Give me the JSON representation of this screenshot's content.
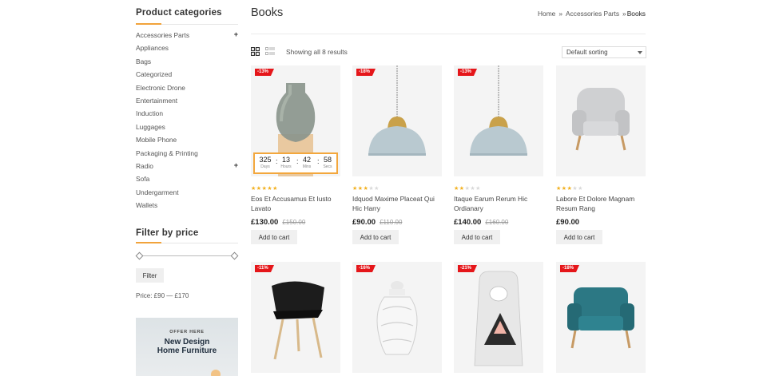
{
  "sidebar": {
    "categories_title": "Product categories",
    "categories": [
      {
        "label": "Accessories Parts",
        "expandable": true
      },
      {
        "label": "Appliances",
        "expandable": false
      },
      {
        "label": "Bags",
        "expandable": false
      },
      {
        "label": "Categorized",
        "expandable": false
      },
      {
        "label": "Electronic Drone",
        "expandable": false
      },
      {
        "label": "Entertainment",
        "expandable": false
      },
      {
        "label": "Induction",
        "expandable": false
      },
      {
        "label": "Luggages",
        "expandable": false
      },
      {
        "label": "Mobile Phone",
        "expandable": false
      },
      {
        "label": "Packaging & Printing",
        "expandable": false
      },
      {
        "label": "Radio",
        "expandable": true
      },
      {
        "label": "Sofa",
        "expandable": false
      },
      {
        "label": "Undergarment",
        "expandable": false
      },
      {
        "label": "Wallets",
        "expandable": false
      }
    ],
    "expand_icon": "+",
    "price_title": "Filter by price",
    "filter_button": "Filter",
    "price_range": "Price: £90 — £170",
    "banner": {
      "offer": "OFFER HERE",
      "line1": "New Design",
      "line2": "Home Furniture"
    }
  },
  "header": {
    "title": "Books",
    "breadcrumb": {
      "home": "Home",
      "separator": "»",
      "parent": "Accessories Parts",
      "current": "Books"
    }
  },
  "toolbar": {
    "result_count": "Showing all 8 results",
    "sort_selected": "Default sorting",
    "icons": [
      "grid-view-icon",
      "list-view-icon"
    ]
  },
  "countdown": {
    "days": "325",
    "days_label": "Days",
    "hours": "13",
    "hours_label": "Hours",
    "mins": "42",
    "mins_label": "Mins",
    "secs": "58",
    "secs_label": "Secs"
  },
  "products": [
    {
      "badge": "-13%",
      "name": "Eos Et Accusamus Et Iusto Lavato",
      "price": "£130.00",
      "old_price": "£150.00",
      "rating": 5,
      "image": "glass-vase",
      "cart": "Add to cart"
    },
    {
      "badge": "-18%",
      "name": "Idquod Maxime Placeat Qui Hic Harry",
      "price": "£90.00",
      "old_price": "£110.00",
      "rating": 3,
      "image": "pendant-lamp",
      "cart": "Add to cart"
    },
    {
      "badge": "-13%",
      "name": "Itaque Earum Rerum Hic Ordianary",
      "price": "£140.00",
      "old_price": "£160.00",
      "rating": 2,
      "image": "pendant-lamp",
      "cart": "Add to cart"
    },
    {
      "badge": "",
      "name": "Labore Et Dolore Magnam Resum Rang",
      "price": "£90.00",
      "old_price": "",
      "rating": 3,
      "image": "armchair",
      "cart": "Add to cart"
    },
    {
      "badge": "-11%",
      "name": "",
      "price": "",
      "old_price": "",
      "rating": 0,
      "image": "black-chair",
      "cart": ""
    },
    {
      "badge": "-16%",
      "name": "",
      "price": "",
      "old_price": "",
      "rating": 0,
      "image": "ceramic-jar",
      "cart": ""
    },
    {
      "badge": "-21%",
      "name": "",
      "price": "",
      "old_price": "",
      "rating": 0,
      "image": "storage-bag",
      "cart": ""
    },
    {
      "badge": "-18%",
      "name": "",
      "price": "",
      "old_price": "",
      "rating": 0,
      "image": "teal-armchair",
      "cart": ""
    }
  ],
  "colors": {
    "accent": "#f1a33b",
    "sale_badge": "#e5161a",
    "star": "#f2b01e"
  }
}
